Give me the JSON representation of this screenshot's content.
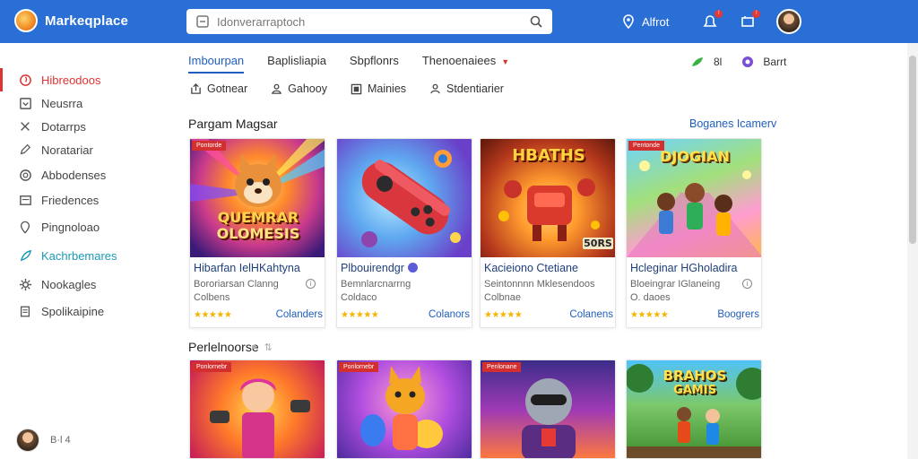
{
  "header": {
    "app_title": "Markeqplace",
    "search_placeholder": "Idonverarraptoch",
    "alerts_label": "Alfrot",
    "notif_badge_1": "!",
    "notif_badge_2": "!"
  },
  "sidebar": {
    "items": [
      {
        "label": "Hibreodoos",
        "icon": "fire-icon"
      },
      {
        "label": "Neusrra",
        "icon": "inbox-icon"
      },
      {
        "label": "Dotarrps",
        "icon": "close-icon"
      },
      {
        "label": "Noratariar",
        "icon": "edit-icon"
      },
      {
        "label": "Abbodenses",
        "icon": "shield-icon"
      },
      {
        "label": "Friedences",
        "icon": "list-icon"
      },
      {
        "label": "Pingnoloao",
        "icon": "location-icon"
      },
      {
        "label": "Kachrbemares",
        "icon": "feather-icon"
      },
      {
        "label": "Nookagles",
        "icon": "gear-icon"
      },
      {
        "label": "Spolikaipine",
        "icon": "document-icon"
      }
    ],
    "user_text": "B·l  4"
  },
  "tabs": [
    {
      "label": "Imbourpan"
    },
    {
      "label": "Baplisliapia"
    },
    {
      "label": "Sbpflonrs"
    },
    {
      "label": "Thenoenaiees"
    }
  ],
  "tab_tools": {
    "count": "8l",
    "more_label": "Barrt"
  },
  "filters": [
    {
      "label": "Gotnear",
      "icon": "export-icon"
    },
    {
      "label": "Gahooy",
      "icon": "person-icon"
    },
    {
      "label": "Mainies",
      "icon": "grid-icon"
    },
    {
      "label": "Stdentiarier",
      "icon": "user-icon"
    }
  ],
  "section1": {
    "title": "Pargam Magsar",
    "link": "Boganes Icamerv"
  },
  "section2": {
    "title": "Perlelnoorse"
  },
  "cards": [
    {
      "tag": "Pontorde",
      "title": "Hibarfan IelHKahtyna",
      "sub": "Bororiarsan Clanng",
      "sub2": "Colbens",
      "link": "Colanders",
      "stars": "★★★★★",
      "art_text_1": "QUEMRAR",
      "art_text_2": "OLOMESIS"
    },
    {
      "tag": "",
      "title": "Plbouirendgr",
      "sub": "Bemnlarcnarrng",
      "sub2": "Coldaco",
      "link": "Colanors",
      "stars": "★★★★★",
      "art_text_1": "",
      "art_text_2": ""
    },
    {
      "tag": "",
      "title": "Kacieiono Ctetiane",
      "sub": "Seintonnnn Mklesendoos",
      "sub2": "Colbnae",
      "link": "Colanens",
      "stars": "★★★★★",
      "art_text_1": "HBATHS",
      "art_text_2": "50RS"
    },
    {
      "tag": "Pentonde",
      "title": "Hcleginar HGholadira",
      "sub": "Bloeingrar IGlaneing",
      "sub2": "O. daoes",
      "link": "Boogrers",
      "stars": "★★★★★",
      "art_text_1": "DJOGIAN",
      "art_text_2": ""
    },
    {
      "tag": "Ponlornebr",
      "title": "",
      "sub": "",
      "sub2": "",
      "link": "",
      "stars": "",
      "art_text_1": "",
      "art_text_2": ""
    },
    {
      "tag": "Ponlornebr",
      "title": "",
      "sub": "",
      "sub2": "",
      "link": "",
      "stars": "",
      "art_text_1": "",
      "art_text_2": ""
    },
    {
      "tag": "Penlonane",
      "title": "",
      "sub": "",
      "sub2": "",
      "link": "",
      "stars": "",
      "art_text_1": "",
      "art_text_2": ""
    },
    {
      "tag": "",
      "title": "",
      "sub": "",
      "sub2": "",
      "link": "",
      "stars": "",
      "art_text_1": "BRAHOS",
      "art_text_2": "GAMIS"
    }
  ],
  "colors": {
    "topbar": "#2a6fd6",
    "accent_red": "#d33",
    "link_blue": "#1f5fbf"
  }
}
